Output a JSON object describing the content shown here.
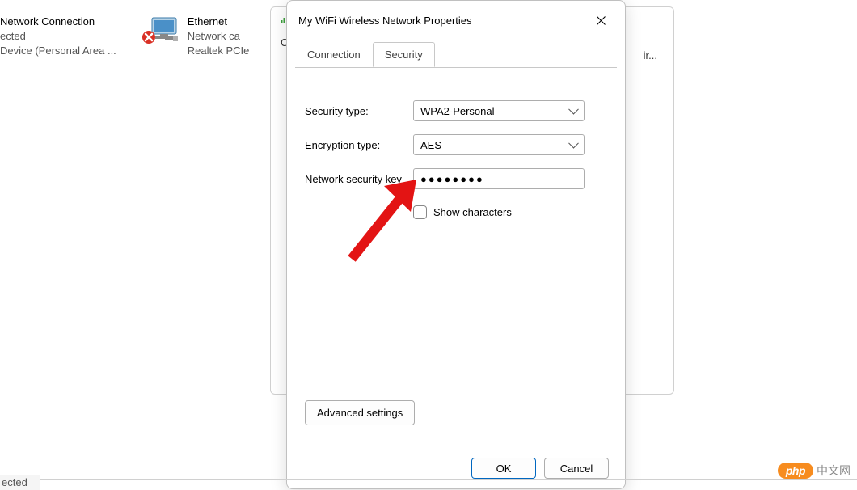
{
  "background": {
    "connection1": {
      "name": "Network Connection",
      "status": "ected",
      "device": "Device (Personal Area ..."
    },
    "connection2": {
      "name": "Ethernet",
      "status": "Network ca",
      "device": "Realtek PCIe"
    },
    "bg_dialog_letter1": "C",
    "bg_dialog_text2": "ir...",
    "bottom_text": "ected"
  },
  "dialog": {
    "title": "My WiFi Wireless Network Properties",
    "tabs": {
      "connection": "Connection",
      "security": "Security"
    },
    "form": {
      "security_type_label": "Security type:",
      "security_type_value": "WPA2-Personal",
      "encryption_type_label": "Encryption type:",
      "encryption_type_value": "AES",
      "network_key_label": "Network security key",
      "network_key_value": "●●●●●●●●",
      "show_characters_label": "Show characters"
    },
    "advanced_button": "Advanced settings",
    "footer": {
      "ok": "OK",
      "cancel": "Cancel"
    }
  },
  "watermark": {
    "badge": "php",
    "text": "中文网"
  }
}
